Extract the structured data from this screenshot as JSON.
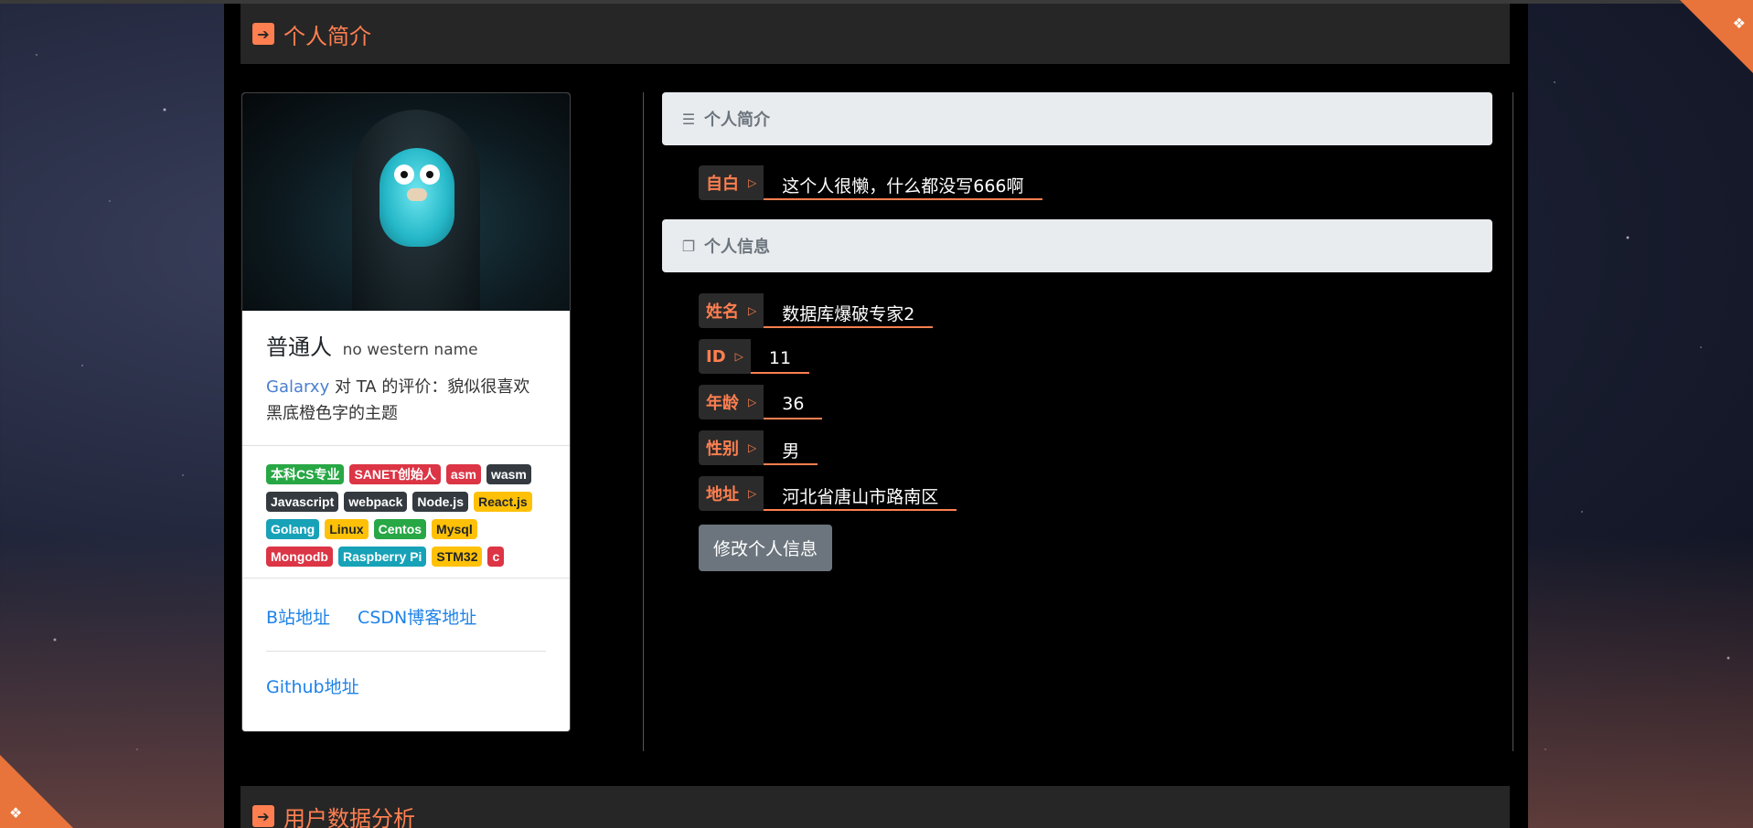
{
  "sections": {
    "profile_header": "个人简介",
    "analysis_header": "用户数据分析"
  },
  "card": {
    "name": "普通人",
    "english_name": "no western name",
    "bio_link": "Galarxy",
    "bio_text": "对 TA 的评价：貌似很喜欢黑底橙色字的主题",
    "badges": [
      {
        "label": "本科CS专业",
        "color": "green"
      },
      {
        "label": "SANET创始人",
        "color": "red"
      },
      {
        "label": "asm",
        "color": "red"
      },
      {
        "label": "wasm",
        "color": "dark"
      },
      {
        "label": "Javascript",
        "color": "dark"
      },
      {
        "label": "webpack",
        "color": "dark"
      },
      {
        "label": "Node.js",
        "color": "dark"
      },
      {
        "label": "React.js",
        "color": "yellow"
      },
      {
        "label": "Golang",
        "color": "teal"
      },
      {
        "label": "Linux",
        "color": "yellow"
      },
      {
        "label": "Centos",
        "color": "green"
      },
      {
        "label": "Mysql",
        "color": "yellow"
      },
      {
        "label": "Mongodb",
        "color": "red"
      },
      {
        "label": "Raspberry Pi",
        "color": "teal"
      },
      {
        "label": "STM32",
        "color": "yellow"
      },
      {
        "label": "c",
        "color": "red"
      }
    ],
    "links": {
      "bilibili": "B站地址",
      "csdn": "CSDN博客地址",
      "github": "Github地址"
    }
  },
  "panel": {
    "intro_title": "个人简介",
    "info_title": "个人信息",
    "fields": {
      "self": {
        "label": "自白",
        "value": "这个人很懒，什么都没写666啊"
      },
      "name": {
        "label": "姓名",
        "value": "数据库爆破专家2"
      },
      "id": {
        "label": "ID",
        "value": "11"
      },
      "age": {
        "label": "年龄",
        "value": "36"
      },
      "gender": {
        "label": "性别",
        "value": "男"
      },
      "address": {
        "label": "地址",
        "value": "河北省唐山市路南区"
      }
    },
    "edit_button": "修改个人信息"
  },
  "colors": {
    "accent": "#ff7f50",
    "link": "#1e82e8"
  }
}
